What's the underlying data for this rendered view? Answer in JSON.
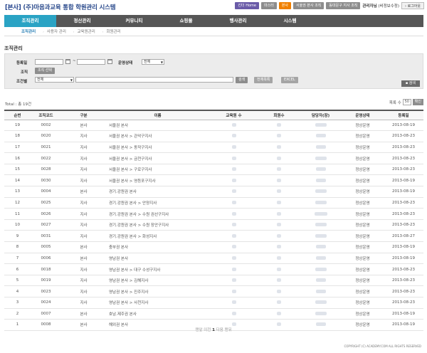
{
  "header": {
    "title_branch": "[본사]",
    "title_main": "(주)마음과교육 통합 학원관리 시스템",
    "links": {
      "kinder": "킨더 Home",
      "master": "마스터",
      "hq": "본사",
      "seoul_hq": "서울권 본사 조직",
      "dongdaemun": "동대문구 지사 조직"
    },
    "user_label": "관리자님",
    "user_info": "(비정보수정)",
    "logout": "로그아웃"
  },
  "colors": {
    "active_tab": "#2aa3c4",
    "nav_bg": "#565656",
    "accent_link": "#f08000"
  },
  "nav": {
    "items": [
      "조직관리",
      "정산관리",
      "커뮤니티",
      "쇼핑몰",
      "행사관리",
      "시스템"
    ]
  },
  "subnav": {
    "items": [
      "조직관리",
      "사용자 관리",
      "교육원관리",
      "회원관리"
    ]
  },
  "page": {
    "title": "조직관리"
  },
  "search": {
    "reg_date_label": "등록일",
    "tilde": "~",
    "status_label": "운영상태",
    "status_value": "전체",
    "org_label": "조직",
    "org_select_btn": "조직 선택",
    "cond_label": "조건별",
    "cond_value": "전체",
    "search_btn": "검색",
    "all_list_btn": "전체목록",
    "excel_btn": "EXCEL",
    "side_search_btn": "검색"
  },
  "list": {
    "total": "Total : 총 19건",
    "count_label": "목록 수",
    "count_value": "50",
    "confirm": "확인"
  },
  "table": {
    "headers": [
      "순번",
      "조직코드",
      "구분",
      "이름",
      "교육원 수",
      "회원수",
      "담당자(장)",
      "운영상태",
      "등록일"
    ],
    "rows": [
      {
        "no": "19",
        "code": "0002",
        "type": "본사",
        "name": "서울권 본사",
        "status": "정상운영",
        "date": "2013-08-19"
      },
      {
        "no": "18",
        "code": "0020",
        "type": "지사",
        "name": "서울권 본사 > 관악구지사",
        "status": "정상운영",
        "date": "2013-08-23"
      },
      {
        "no": "17",
        "code": "0021",
        "type": "지사",
        "name": "서울권 본사 > 동작구지사",
        "status": "정상운영",
        "date": "2013-08-23"
      },
      {
        "no": "16",
        "code": "0022",
        "type": "지사",
        "name": "서울권 본사 > 금천구지사",
        "status": "정상운영",
        "date": "2013-08-23"
      },
      {
        "no": "15",
        "code": "0028",
        "type": "지사",
        "name": "서울권 본사 > 구로구지사",
        "status": "정상운영",
        "date": "2013-08-23"
      },
      {
        "no": "14",
        "code": "0030",
        "type": "지사",
        "name": "서울권 본사 > 영등포구지사",
        "status": "정상운영",
        "date": "2013-08-19"
      },
      {
        "no": "13",
        "code": "0004",
        "type": "본사",
        "name": "경기.강원권 본사",
        "status": "정상운영",
        "date": "2013-08-19"
      },
      {
        "no": "12",
        "code": "0025",
        "type": "지사",
        "name": "경기.강원권 본사 > 안양지사",
        "status": "정상운영",
        "date": "2013-08-23"
      },
      {
        "no": "11",
        "code": "0026",
        "type": "지사",
        "name": "경기.강원권 본사 > 수원 권선구지사",
        "status": "정상운영",
        "date": "2013-08-23"
      },
      {
        "no": "10",
        "code": "0027",
        "type": "지사",
        "name": "경기.강원권 본사 > 수원 장안구지사",
        "status": "정상운영",
        "date": "2013-08-23"
      },
      {
        "no": "9",
        "code": "0031",
        "type": "지사",
        "name": "경기.강원권 본사 > 화성지사",
        "status": "정상운영",
        "date": "2013-08-27"
      },
      {
        "no": "8",
        "code": "0005",
        "type": "본사",
        "name": "충부권 본사",
        "status": "정상운영",
        "date": "2013-08-19"
      },
      {
        "no": "7",
        "code": "0006",
        "type": "본사",
        "name": "영남권 본사",
        "status": "정상운영",
        "date": "2013-08-19"
      },
      {
        "no": "6",
        "code": "0018",
        "type": "지사",
        "name": "영남권 본사 > 대구 수성구지사",
        "status": "정상운영",
        "date": "2013-08-23"
      },
      {
        "no": "5",
        "code": "0019",
        "type": "지사",
        "name": "영남권 본사 > 김해지사",
        "status": "정상운영",
        "date": "2013-08-23"
      },
      {
        "no": "4",
        "code": "0023",
        "type": "지사",
        "name": "영남권 본사 > 진주지사",
        "status": "정상운영",
        "date": "2013-08-23"
      },
      {
        "no": "3",
        "code": "0024",
        "type": "지사",
        "name": "영남권 본사 > 사천지사",
        "status": "정상운영",
        "date": "2013-08-23"
      },
      {
        "no": "2",
        "code": "0007",
        "type": "본사",
        "name": "호남.제주권 본사",
        "status": "정상운영",
        "date": "2013-08-19"
      },
      {
        "no": "1",
        "code": "0008",
        "type": "본사",
        "name": "해외권 본사",
        "status": "정상운영",
        "date": "2013-08-19"
      }
    ]
  },
  "pager": {
    "first": "맨앞",
    "prev": "이전",
    "current": "1",
    "next": "다음",
    "last": "맨뒤"
  },
  "footer": {
    "copyright": "COPYRIGHT (C) ACADEMY.COM ALL RIGHTS RESERVED"
  }
}
